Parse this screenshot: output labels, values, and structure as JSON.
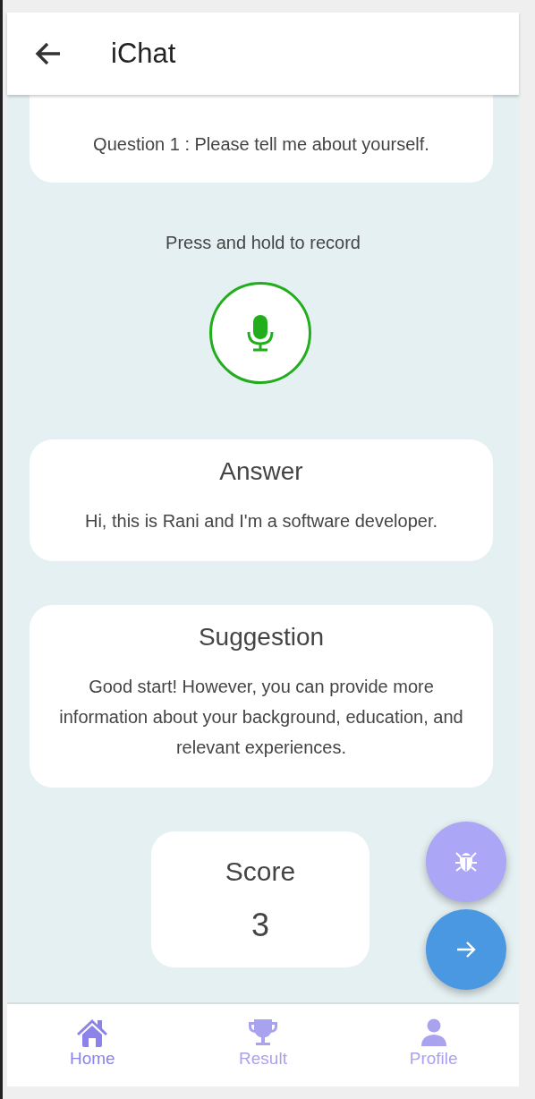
{
  "app_bar": {
    "title": "iChat"
  },
  "question_card": {
    "text": "Question 1 : Please tell me about yourself."
  },
  "record_hint": "Press and hold to record",
  "answer_card": {
    "title": "Answer",
    "text": "Hi, this is Rani and I'm a software developer."
  },
  "suggestion_card": {
    "title": "Suggestion",
    "text": "Good start! However, you can provide more information about your background, education, and relevant experiences."
  },
  "score_card": {
    "title": "Score",
    "value": "3"
  },
  "fabs": [
    {
      "kind": "bug"
    },
    {
      "kind": "next"
    }
  ],
  "nav": [
    {
      "label": "Home",
      "kind": "home",
      "selected": true
    },
    {
      "label": "Result",
      "kind": "trophy",
      "selected": false
    },
    {
      "label": "Profile",
      "kind": "person",
      "selected": false
    }
  ]
}
